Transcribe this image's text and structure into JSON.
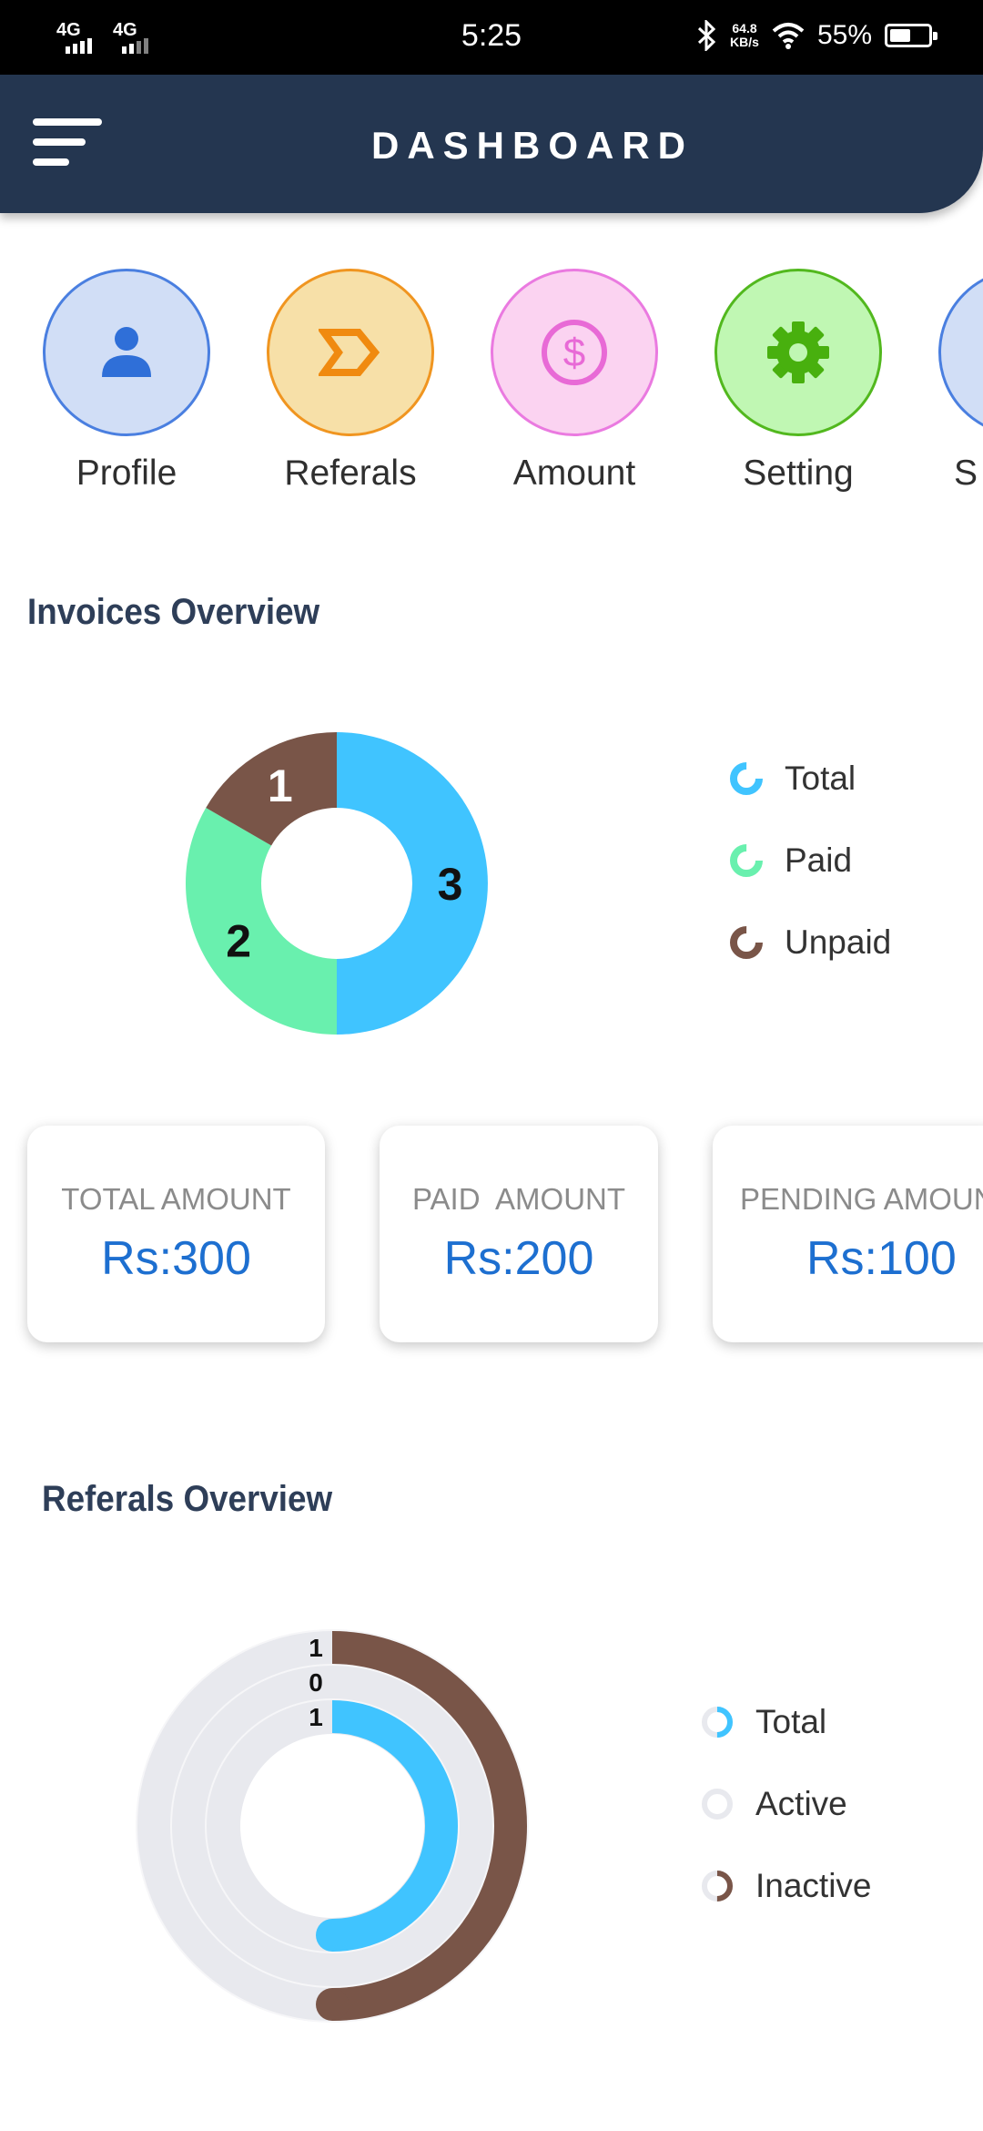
{
  "status_bar": {
    "network_1": "4G",
    "network_2": "4G",
    "time": "5:25",
    "speed_value": "64.8",
    "speed_unit": "KB/s",
    "battery": "55%",
    "battery_level": 0.55,
    "icons": [
      "signal-icon",
      "bluetooth-icon",
      "wifi-icon",
      "battery-icon"
    ]
  },
  "header": {
    "title": "DASHBOARD",
    "menu_icon": "menu-icon",
    "background_color": "#243650"
  },
  "quick_actions": [
    {
      "label": "Profile",
      "icon": "person-icon",
      "bg": "#d1def6",
      "border": "#4a7fe0",
      "icon_color": "#2f6fd8"
    },
    {
      "label": "Referals",
      "icon": "chevron-tag-icon",
      "bg": "#f7e0a8",
      "border": "#f09520",
      "icon_color": "#f08a10"
    },
    {
      "label": "Amount",
      "icon": "dollar-icon",
      "bg": "#fbd3f1",
      "border": "#ea7ae0",
      "icon_color": "#e86ad6"
    },
    {
      "label": "Setting",
      "icon": "gear-icon",
      "bg": "#c0f7b3",
      "border": "#52b81e",
      "icon_color": "#48b00e"
    },
    {
      "label": "S",
      "icon": "",
      "bg": "#d1def6",
      "border": "#4a7fe0",
      "icon_color": "#2f6fd8"
    }
  ],
  "invoices": {
    "title": "Invoices Overview",
    "legend": [
      {
        "label": "Total",
        "color": "#40c4ff"
      },
      {
        "label": "Paid",
        "color": "#69f0ae"
      },
      {
        "label": "Unpaid",
        "color": "#795548"
      }
    ]
  },
  "cards": [
    {
      "label": "TOTAL AMOUNT",
      "value": "Rs:300"
    },
    {
      "label": "PAID  AMOUNT",
      "value": "Rs:200"
    },
    {
      "label": "PENDING AMOUNT",
      "value": "Rs:100"
    }
  ],
  "referrals": {
    "title": "Referals Overview",
    "legend": [
      {
        "label": "Total",
        "color": "#40c4ff"
      },
      {
        "label": "Active",
        "color": "#e8e9ee"
      },
      {
        "label": "Inactive",
        "color": "#795548"
      }
    ],
    "track_color": "#e8e9ee"
  },
  "chart_data": [
    {
      "type": "pie",
      "title": "Invoices Overview",
      "labels": [
        "Total",
        "Paid",
        "Unpaid"
      ],
      "values": [
        3,
        2,
        1
      ],
      "colors": [
        "#40c4ff",
        "#69f0ae",
        "#795548"
      ],
      "donut": true,
      "data_labels": [
        "3",
        "2",
        "1"
      ]
    },
    {
      "type": "radial-bar",
      "title": "Referals Overview",
      "series": [
        {
          "name": "Inactive",
          "value": 1,
          "color": "#795548"
        },
        {
          "name": "Active",
          "value": 0,
          "color": "#e8e9ee"
        },
        {
          "name": "Total",
          "value": 1,
          "color": "#40c4ff"
        }
      ],
      "max": 2,
      "data_labels": [
        "1",
        "0",
        "1"
      ]
    }
  ]
}
